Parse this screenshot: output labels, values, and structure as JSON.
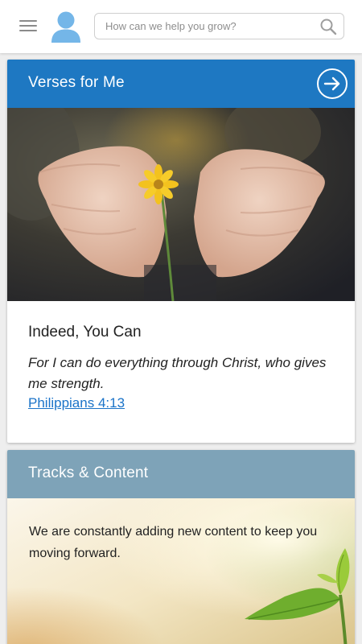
{
  "header": {
    "search_placeholder": "How can we help you grow?"
  },
  "verses_card": {
    "title": "Verses for Me",
    "heading": "Indeed, You Can",
    "verse_text": "For I can do everything through Christ, who gives me strength.",
    "reference": "Philippians 4:13",
    "header_color": "#1e78c2",
    "link_color": "#1a73c8"
  },
  "tracks_card": {
    "title": "Tracks & Content",
    "description": "We are constantly adding new content to keep you moving forward.",
    "header_color": "#7ea3b8"
  }
}
